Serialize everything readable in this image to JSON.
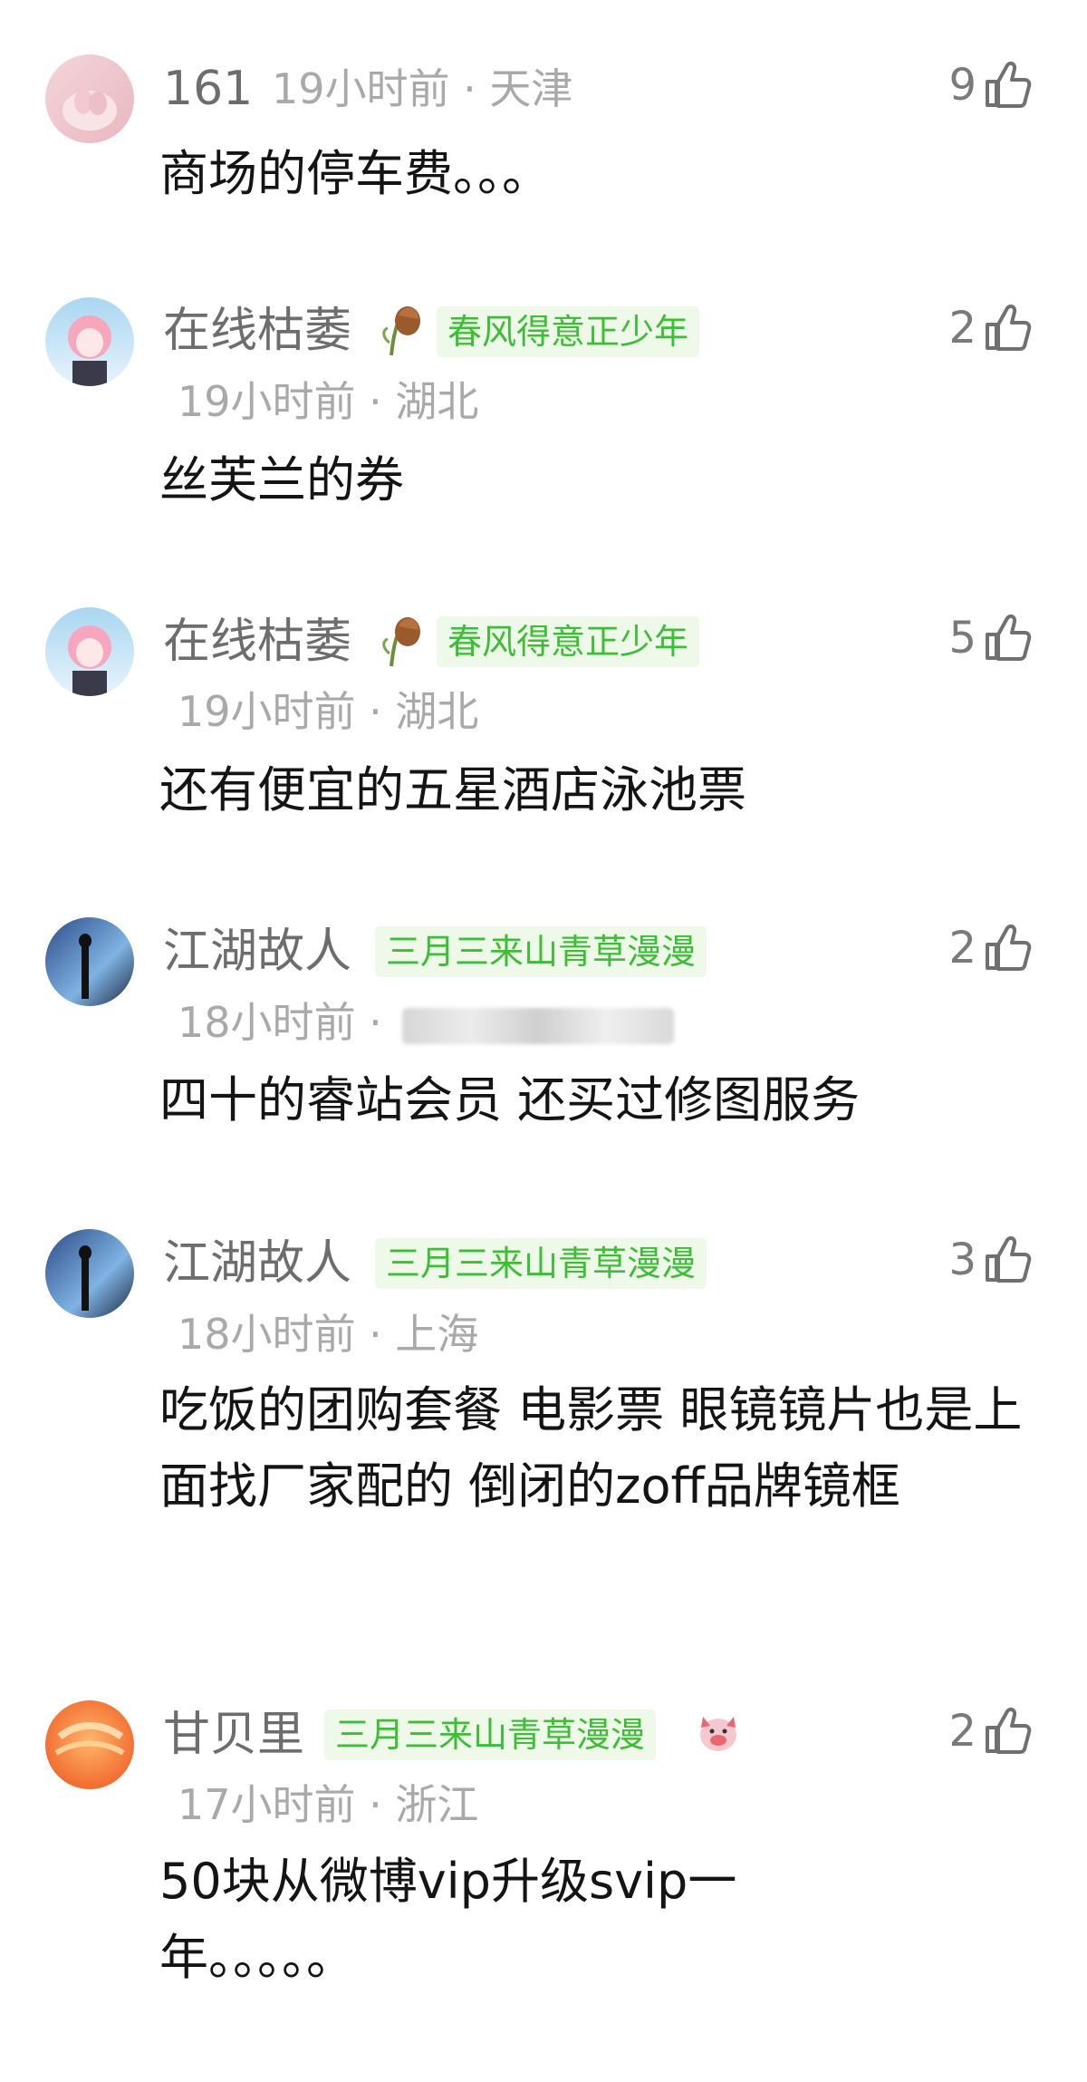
{
  "colors": {
    "name": "#6d6d6d",
    "meta": "#a9a9a9",
    "badge_bg": "#eef9ea",
    "badge_text": "#3ebd37",
    "body": "#141414"
  },
  "comments": [
    {
      "user": "161",
      "time": "19小时前 · 天津",
      "likes": "9",
      "text": "商场的停车费。。。",
      "avatar": "avatar-pink-hands"
    },
    {
      "user": "在线枯萎",
      "badge": "春风得意正少年",
      "time": "19小时前 · 湖北",
      "likes": "2",
      "text": "丝芙兰的券",
      "avatar": "avatar-anime-girl"
    },
    {
      "user": "在线枯萎",
      "badge": "春风得意正少年",
      "time": "19小时前 · 湖北",
      "likes": "5",
      "text": "还有便宜的五星酒店泳池票",
      "avatar": "avatar-anime-girl"
    },
    {
      "user": "江湖故人",
      "badge": "三月三来山青草漫漫",
      "time": "18小时前 · ",
      "likes": "2",
      "text": "四十的睿站会员 还买过修图服务",
      "avatar": "avatar-sky-silhouette"
    },
    {
      "user": "江湖故人",
      "badge": "三月三来山青草漫漫",
      "time": "18小时前 · 上海",
      "likes": "3",
      "text": "吃饭的团购套餐 电影票 眼镜镜片也是上面找厂家配的 倒闭的zoff品牌镜框",
      "avatar": "avatar-sky-silhouette"
    },
    {
      "user": "甘贝里",
      "badge": "三月三来山青草漫漫",
      "time": "17小时前 · 浙江",
      "likes": "2",
      "text": "50块从微博vip升级svip一年。。。。。",
      "avatar": "avatar-orange"
    }
  ]
}
